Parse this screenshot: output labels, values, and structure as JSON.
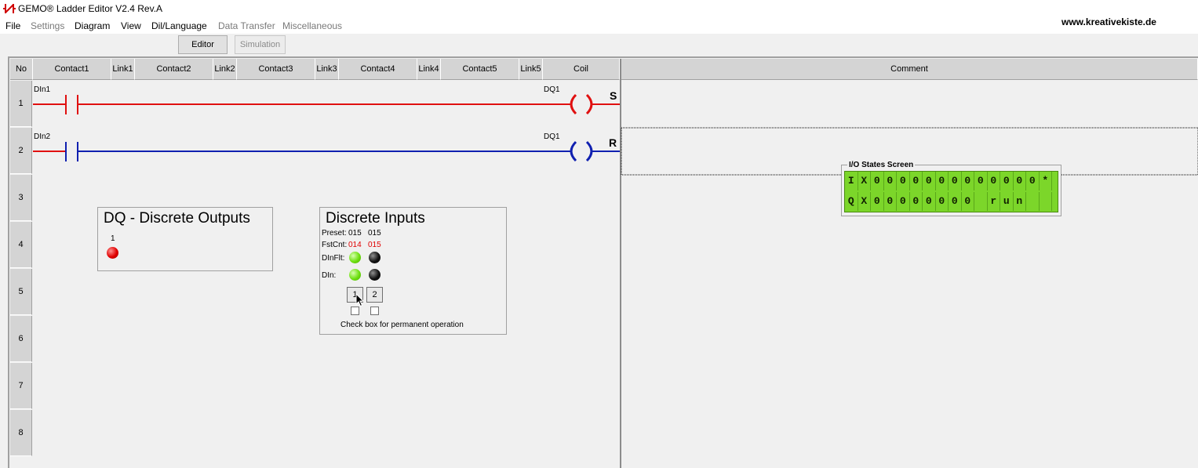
{
  "window": {
    "title": "GEMO® Ladder Editor V2.4 Rev.A",
    "website": "www.kreativekiste.de"
  },
  "menu": [
    "File",
    "Settings",
    "Diagram",
    "View",
    "Dil/Language",
    "Data Transfer",
    "Miscellaneous"
  ],
  "toolbar": {
    "editor_label": "Editor",
    "simulation_label": "Simulation"
  },
  "grid_headers": [
    "No",
    "Contact1",
    "Link1",
    "Contact2",
    "Link2",
    "Contact3",
    "Link3",
    "Contact4",
    "Link4",
    "Contact5",
    "Link5",
    "Coil",
    "Comment"
  ],
  "row_numbers": [
    "1",
    "2",
    "3",
    "4",
    "5",
    "6",
    "7",
    "8"
  ],
  "rungs": [
    {
      "contact_label": "DIn1",
      "coil_label": "DQ1",
      "coil_type": "S",
      "color": "#e01010"
    },
    {
      "contact_label": "DIn2",
      "coil_label": "DQ1",
      "coil_type": "R",
      "color": "#1020b0"
    }
  ],
  "dq_panel": {
    "title": "DQ - Discrete Outputs",
    "output_number": "1",
    "output_state_color": "red"
  },
  "di_panel": {
    "title": "Discrete Inputs",
    "preset_label": "Preset:",
    "preset_values": [
      "015",
      "015"
    ],
    "fstcnt_label": "FstCnt:",
    "fstcnt_values": [
      "014",
      "015"
    ],
    "dinflt_label": "DInFlt:",
    "din_label": "DIn:",
    "button_labels": [
      "1",
      "2"
    ],
    "checkbox_caption": "Check box for permanent operation"
  },
  "io_screen": {
    "title": "I/O States Screen",
    "row1": [
      "I",
      "X",
      "0",
      "0",
      "0",
      "0",
      "0",
      "0",
      "0",
      "0",
      "0",
      "0",
      "0",
      "0",
      "0",
      "*"
    ],
    "row2": [
      "Q",
      "X",
      "0",
      "0",
      "0",
      "0",
      "0",
      "0",
      "0",
      "0",
      "",
      "r",
      "u",
      "n",
      "",
      ""
    ]
  }
}
